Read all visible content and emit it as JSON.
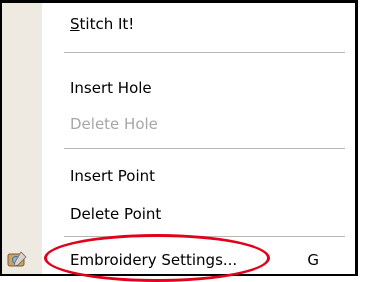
{
  "context_menu": {
    "items": [
      {
        "label": "Stitch It!",
        "enabled": true,
        "mnemonic": "S"
      },
      {
        "label": "Insert Hole",
        "enabled": true
      },
      {
        "label": "Delete Hole",
        "enabled": false
      },
      {
        "label": "Insert Point",
        "enabled": true
      },
      {
        "label": "Delete Point",
        "enabled": true
      },
      {
        "label": "Embroidery Settings...",
        "enabled": true,
        "shortcut": "G",
        "icon": "embroidery-settings-icon"
      }
    ],
    "highlight_color": "#e2001a",
    "gutter_color": "#eeeae2"
  }
}
